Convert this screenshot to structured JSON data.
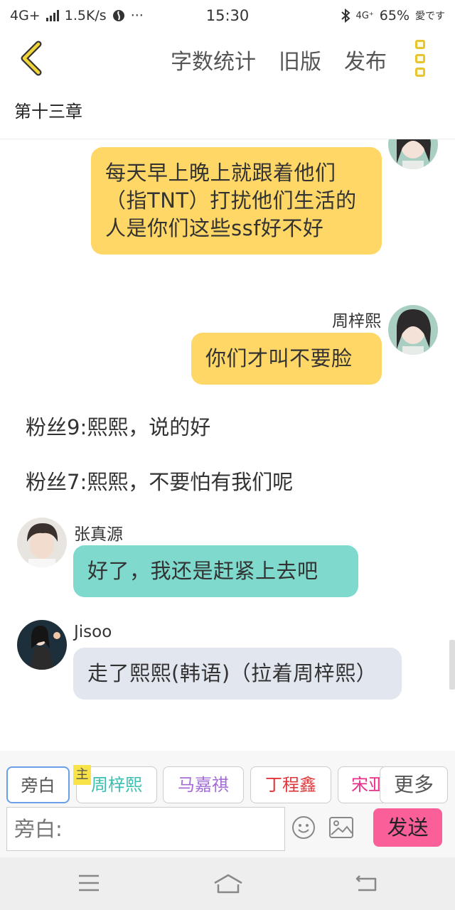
{
  "status_bar": {
    "network": "4G+",
    "speed": "1.5K/s",
    "time": "15:30",
    "right_network": "4G⁺",
    "battery": "65%",
    "carrier": "愛です"
  },
  "header": {
    "word_count": "字数统计",
    "old_version": "旧版",
    "publish": "发布"
  },
  "chapter": {
    "title": "第十三章"
  },
  "messages": {
    "m1": {
      "text": "每天早上晚上就跟着他们（指TNT）打扰他们生活的人是你们这些ssf好不好"
    },
    "m2": {
      "sender": "周梓熙",
      "text": "你们才叫不要脸"
    },
    "n1": {
      "text": "粉丝9:熙熙，说的好"
    },
    "n2": {
      "text": "粉丝7:熙熙，不要怕有我们呢"
    },
    "m3": {
      "sender": "张真源",
      "text": "好了，我还是赶紧上去吧"
    },
    "m4": {
      "sender": "Jisoo",
      "text": "走了熙熙(韩语)（拉着周梓熙）"
    }
  },
  "roles": {
    "narration": "旁白",
    "host_badge": "主",
    "r1": "周梓熙",
    "r2": "马嘉祺",
    "r3": "丁程鑫",
    "r4": "宋亚",
    "more": "更多"
  },
  "input": {
    "placeholder": "旁白:",
    "send": "发送"
  },
  "colors": {
    "accent_yellow": "#ffd767",
    "teal": "#7fd9cc",
    "grey_bubble": "#e1e6ef",
    "send_pink": "#fa5f9a",
    "role_zhou": "#3bbfb0",
    "role_ma": "#a46cd6",
    "role_ding": "#e0363a",
    "role_song": "#e8308b"
  }
}
